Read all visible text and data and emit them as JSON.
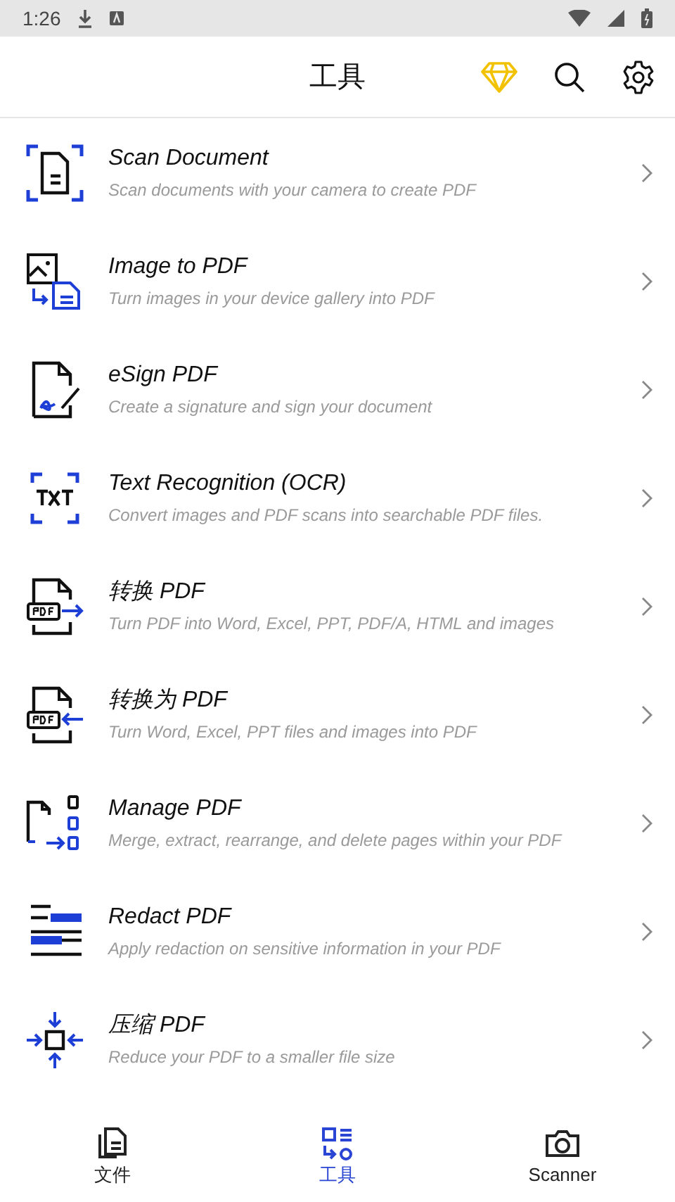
{
  "status_bar": {
    "time": "1:26"
  },
  "header": {
    "title": "工具"
  },
  "tools": [
    {
      "title": "Scan Document",
      "subtitle": "Scan documents with your camera to create PDF"
    },
    {
      "title": "Image to PDF",
      "subtitle": "Turn images in your device gallery into PDF"
    },
    {
      "title": "eSign PDF",
      "subtitle": "Create a signature and sign your document"
    },
    {
      "title": "Text Recognition (OCR)",
      "subtitle": "Convert images and PDF scans into searchable PDF files."
    },
    {
      "title": "转换 PDF",
      "subtitle": "Turn PDF into Word, Excel, PPT, PDF/A, HTML and images"
    },
    {
      "title": "转换为 PDF",
      "subtitle": "Turn Word, Excel, PPT files and images into PDF"
    },
    {
      "title": "Manage PDF",
      "subtitle": "Merge, extract, rearrange, and delete pages within your PDF"
    },
    {
      "title": "Redact PDF",
      "subtitle": "Apply redaction on sensitive information in your PDF"
    },
    {
      "title": "压缩 PDF",
      "subtitle": "Reduce your PDF to a smaller file size"
    }
  ],
  "bottom_nav": [
    {
      "label": "文件",
      "selected": false
    },
    {
      "label": "工具",
      "selected": true
    },
    {
      "label": "Scanner",
      "selected": false
    }
  ]
}
